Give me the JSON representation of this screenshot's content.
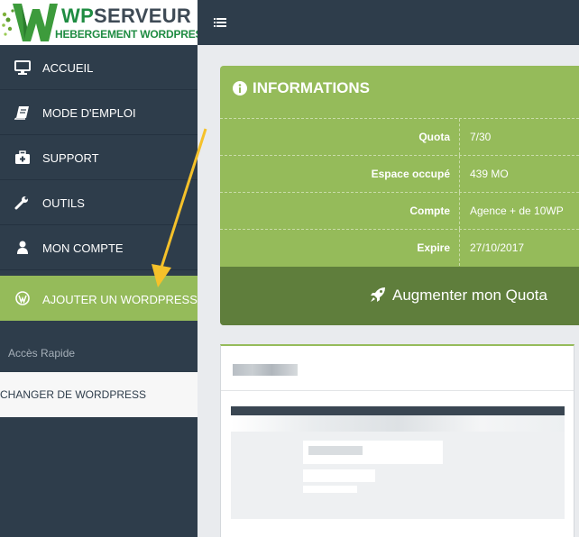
{
  "logo": {
    "title_wp": "WP",
    "title_serveur": "SERVEUR",
    "subtitle": "HEBERGEMENT WORDPRESS"
  },
  "sidebar": {
    "items": [
      {
        "label": "ACCUEIL",
        "icon": "desktop-icon"
      },
      {
        "label": "MODE D'EMPLOI",
        "icon": "book-icon"
      },
      {
        "label": "SUPPORT",
        "icon": "medkit-icon"
      },
      {
        "label": "OUTILS",
        "icon": "wrench-icon"
      },
      {
        "label": "MON COMPTE",
        "icon": "user-icon"
      },
      {
        "label": "AJOUTER UN WORDPRESS",
        "icon": "wordpress-icon",
        "active": true
      }
    ],
    "quick_title": "Accès Rapide",
    "quick_links": [
      {
        "label": "CHANGER DE WORDPRESS"
      }
    ]
  },
  "topbar": {
    "menu_icon": "hamburger-icon"
  },
  "info": {
    "title": "INFORMATIONS",
    "icon": "info-circle-icon",
    "rows": [
      {
        "label": "Quota",
        "value": "7/30"
      },
      {
        "label": "Espace occupé",
        "value": "439 MO"
      },
      {
        "label": "Compte",
        "value": "Agence + de 10WP"
      },
      {
        "label": "Expire",
        "value": "27/10/2017"
      }
    ],
    "button_label": "Augmenter mon Quota",
    "button_icon": "rocket-icon"
  },
  "colors": {
    "sidebar": "#2e3d4b",
    "accent_green": "#95bb5a",
    "dark_green": "#5f7e3c",
    "annotation_arrow": "#f5c12a"
  }
}
